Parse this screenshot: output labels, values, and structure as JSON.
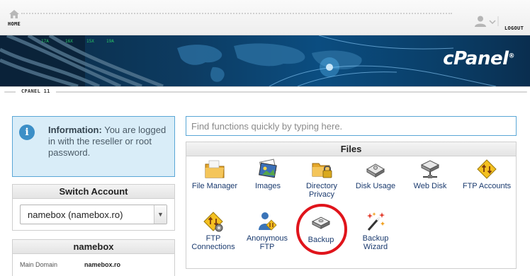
{
  "topbar": {
    "home_label": "HOME",
    "logout_label": "LOGOUT"
  },
  "banner": {
    "brand": "cPanel",
    "brand_mark": "®"
  },
  "strip": {
    "label": "CPANEL 11"
  },
  "info": {
    "title": "Information:",
    "message": "You are logged in with the reseller or root password."
  },
  "switch_account": {
    "title": "Switch Account",
    "selected": "namebox (namebox.ro)"
  },
  "namebox": {
    "title": "namebox",
    "main_domain_label": "Main Domain",
    "main_domain_value": "namebox.ro"
  },
  "search": {
    "placeholder": "Find functions quickly by typing here."
  },
  "files": {
    "title": "Files",
    "items": [
      {
        "label": "File Manager",
        "icon": "folder-icon"
      },
      {
        "label": "Images",
        "icon": "images-icon"
      },
      {
        "label_line1": "Directory",
        "label_line2": "Privacy",
        "icon": "locked-folder-icon"
      },
      {
        "label": "Disk Usage",
        "icon": "disk-icon"
      },
      {
        "label": "Web Disk",
        "icon": "network-disk-icon"
      },
      {
        "label": "FTP Accounts",
        "icon": "ftp-icon"
      },
      {
        "label_line1": "FTP",
        "label_line2": "Connections",
        "icon": "ftp-gear-icon"
      },
      {
        "label_line1": "Anonymous",
        "label_line2": "FTP",
        "icon": "anonymous-user-icon"
      },
      {
        "label": "Backup",
        "icon": "backup-disk-icon"
      },
      {
        "label_line1": "Backup",
        "label_line2": "Wizard",
        "icon": "wand-icon"
      }
    ]
  },
  "colors": {
    "accent_blue": "#5aa7d6",
    "highlight_red": "#e0141b",
    "link": "#1a3a6e"
  }
}
